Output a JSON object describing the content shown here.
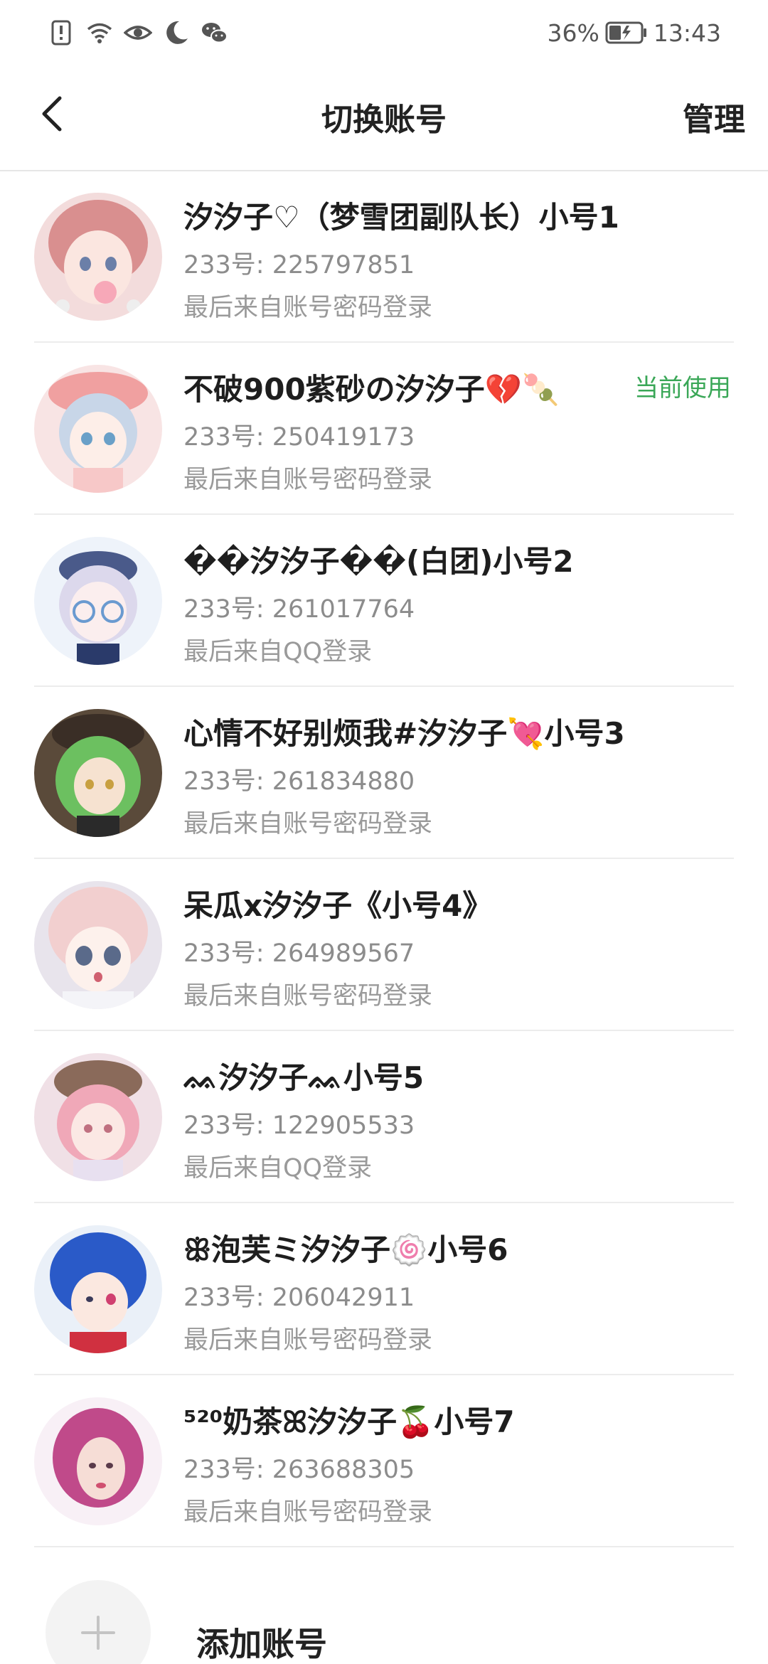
{
  "status_bar": {
    "battery": "36%",
    "time": "13:43",
    "icons": [
      "alert-icon",
      "wifi-icon",
      "eye-icon",
      "moon-icon",
      "wechat-icon",
      "battery-icon"
    ]
  },
  "nav": {
    "title": "切换账号",
    "manage_label": "管理",
    "back_icon": "chevron-left-icon"
  },
  "accounts": [
    {
      "name": "汐汐子♡（梦雪团副队长）小号1",
      "id": "233号: 225797851",
      "login": "最后来自账号密码登录",
      "current": ""
    },
    {
      "name": "不破900紫砂の汐汐子💔🍡",
      "id": "233号: 250419173",
      "login": "最后来自账号密码登录",
      "current": "当前使用"
    },
    {
      "name": "��汐汐子��(白团)小号2",
      "id": "233号: 261017764",
      "login": "最后来自QQ登录",
      "current": ""
    },
    {
      "name": "心情不好别烦我#汐汐子💘小号3",
      "id": "233号: 261834880",
      "login": "最后来自账号密码登录",
      "current": ""
    },
    {
      "name": "呆瓜x汐汐子《小号4》",
      "id": "233号: 264989567",
      "login": "最后来自账号密码登录",
      "current": ""
    },
    {
      "name": "ᨐ汐汐子ᨐ小号5",
      "id": "233号: 122905533",
      "login": "最后来自QQ登录",
      "current": ""
    },
    {
      "name": "ꕥ泡芙ミ汐汐子🍥小号6",
      "id": "233号: 206042911",
      "login": "最后来自账号密码登录",
      "current": ""
    },
    {
      "name": "⁵²⁰奶茶ꕤ汐汐子🍒小号7",
      "id": "233号: 263688305",
      "login": "最后来自账号密码登录",
      "current": ""
    }
  ],
  "add_account": {
    "label": "添加账号",
    "icon": "plus-icon"
  },
  "colors": {
    "accent_green": "#3aa757",
    "divider": "#ececec",
    "secondary_text": "#8c8c8c"
  }
}
